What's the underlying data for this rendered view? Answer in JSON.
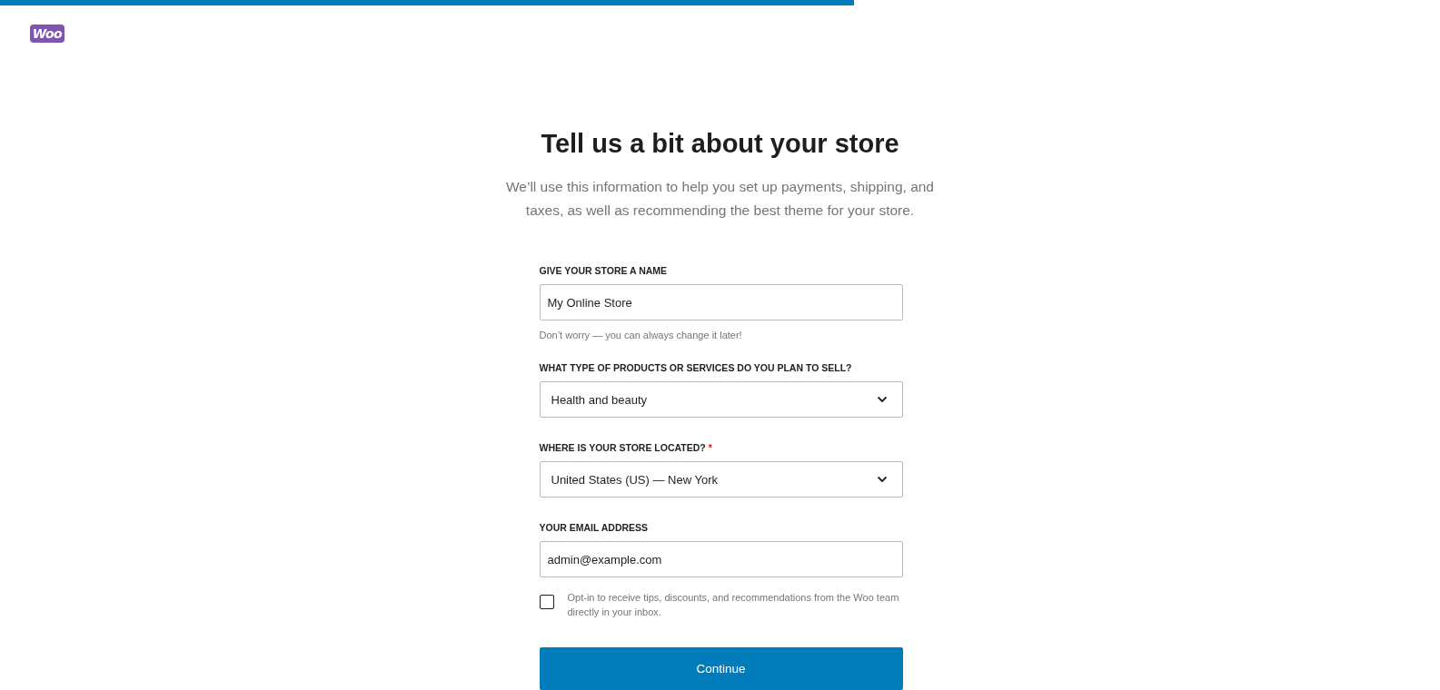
{
  "progress": {
    "level": 0.593
  },
  "logo": {
    "text": "Woo"
  },
  "heading": "Tell us a bit about your store",
  "subtitle": "We’ll use this information to help you set up payments, shipping, and taxes, as well as recommending the best theme for your store.",
  "fields": [
    {
      "kind": "text",
      "label": "GIVE YOUR STORE A NAME",
      "value": "My Online Store",
      "help": "Don’t worry — you can always change it later!"
    },
    {
      "kind": "select",
      "label": "WHAT TYPE OF PRODUCTS OR SERVICES DO YOU PLAN TO SELL?",
      "value": "Health and beauty"
    },
    {
      "kind": "select",
      "label": "WHERE IS YOUR STORE LOCATED?",
      "required_mark": "*",
      "value": "United States (US) — New York"
    },
    {
      "kind": "text",
      "label": "YOUR EMAIL ADDRESS",
      "value": "admin@example.com"
    }
  ],
  "opt_in": {
    "label": "Opt-in to receive tips, discounts, and recommendations from the Woo team directly in your inbox.",
    "checked": false
  },
  "button": "Continue"
}
